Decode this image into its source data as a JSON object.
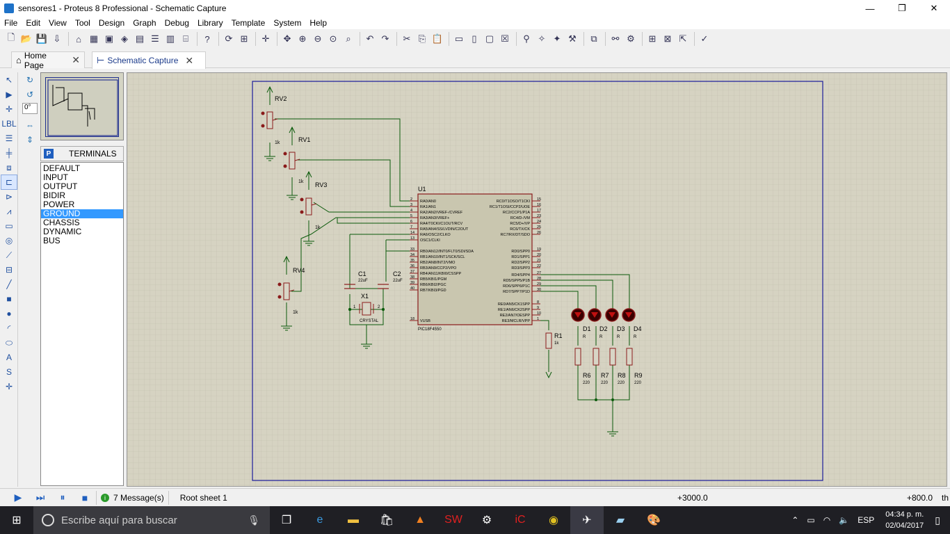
{
  "window": {
    "title": "sensores1 - Proteus 8 Professional - Schematic Capture",
    "minimize": "—",
    "restore": "❐",
    "close": "✕"
  },
  "menu": [
    "File",
    "Edit",
    "View",
    "Tool",
    "Design",
    "Graph",
    "Debug",
    "Library",
    "Template",
    "System",
    "Help"
  ],
  "tabs": [
    {
      "label": "Home Page",
      "icon": "home-icon",
      "active": false
    },
    {
      "label": "Schematic Capture",
      "icon": "schematic-icon",
      "active": true
    }
  ],
  "rotation": {
    "value": "0°"
  },
  "terminals": {
    "mode_badge": "P",
    "header": "TERMINALS",
    "items": [
      "DEFAULT",
      "INPUT",
      "OUTPUT",
      "BIDIR",
      "POWER",
      "GROUND",
      "CHASSIS",
      "DYNAMIC",
      "BUS"
    ],
    "selected": "GROUND"
  },
  "schematic": {
    "pots": [
      {
        "ref": "RV2",
        "value": "1k"
      },
      {
        "ref": "RV1",
        "value": "1k"
      },
      {
        "ref": "RV3",
        "value": "1k"
      },
      {
        "ref": "RV4",
        "value": "1k"
      }
    ],
    "caps": [
      {
        "ref": "C1",
        "value": "22uF"
      },
      {
        "ref": "C2",
        "value": "22uF"
      }
    ],
    "crystal": {
      "ref": "X1",
      "value": "CRYSTAL",
      "pin1": "1",
      "pin2": "2"
    },
    "mcu": {
      "ref": "U1",
      "part": "PIC18F4550",
      "left_pins": [
        {
          "num": "2",
          "name": "RA0/AN0"
        },
        {
          "num": "3",
          "name": "RA1/AN1"
        },
        {
          "num": "4",
          "name": "RA2/AN2/VREF-/CVREF"
        },
        {
          "num": "5",
          "name": "RA3/AN3/VREF+"
        },
        {
          "num": "6",
          "name": "RA4/T0CKI/C1OUT/RCV"
        },
        {
          "num": "7",
          "name": "RA5/AN4/SS/LVDIN/C2OUT"
        },
        {
          "num": "14",
          "name": "RA6/OSC2/CLKO"
        },
        {
          "num": "13",
          "name": "OSC1/CLKI"
        },
        {
          "num": "33",
          "name": "RB0/AN12/INT0/FLT0/SDI/SDA"
        },
        {
          "num": "34",
          "name": "RB1/AN10/INT1/SCK/SCL"
        },
        {
          "num": "35",
          "name": "RB2/AN8/INT2/VMO"
        },
        {
          "num": "36",
          "name": "RB3/AN9/CCP2/VPO"
        },
        {
          "num": "37",
          "name": "RB4/AN11/KBI0/CSSPP"
        },
        {
          "num": "38",
          "name": "RB5/KBI1/PGM"
        },
        {
          "num": "39",
          "name": "RB6/KBI2/PGC"
        },
        {
          "num": "40",
          "name": "RB7/KBI3/PGD"
        },
        {
          "num": "18",
          "name": "VUSB"
        }
      ],
      "right_pins": [
        {
          "num": "15",
          "name": "RC0/T1OSO/T1CKI"
        },
        {
          "num": "16",
          "name": "RC1/T1OSI/CCP2/UOE"
        },
        {
          "num": "17",
          "name": "RC2/CCP1/P1A"
        },
        {
          "num": "23",
          "name": "RC4/D-/VM"
        },
        {
          "num": "24",
          "name": "RC5/D+/VP"
        },
        {
          "num": "25",
          "name": "RC6/TX/CK"
        },
        {
          "num": "26",
          "name": "RC7/RX/DT/SDO"
        },
        {
          "num": "19",
          "name": "RD0/SPP0"
        },
        {
          "num": "20",
          "name": "RD1/SPP1"
        },
        {
          "num": "21",
          "name": "RD2/SPP2"
        },
        {
          "num": "22",
          "name": "RD3/SPP3"
        },
        {
          "num": "27",
          "name": "RD4/SPP4"
        },
        {
          "num": "28",
          "name": "RD5/SPP5/P1B"
        },
        {
          "num": "29",
          "name": "RD6/SPP6/P1C"
        },
        {
          "num": "30",
          "name": "RD7/SPP7/P1D"
        },
        {
          "num": "8",
          "name": "RE0/AN5/CK1SPP"
        },
        {
          "num": "9",
          "name": "RE1/AN6/CK2SPP"
        },
        {
          "num": "10",
          "name": "RE2/AN7/OESPP"
        },
        {
          "num": "1",
          "name": "RE3/MCLR/VPP"
        }
      ]
    },
    "leds": [
      {
        "ref": "D1",
        "value": "R"
      },
      {
        "ref": "D2",
        "value": "R"
      },
      {
        "ref": "D3",
        "value": "R"
      },
      {
        "ref": "D4",
        "value": "R"
      }
    ],
    "led_resistors": [
      {
        "ref": "R6",
        "value": "220"
      },
      {
        "ref": "R7",
        "value": "220"
      },
      {
        "ref": "R8",
        "value": "220"
      },
      {
        "ref": "R9",
        "value": "220"
      }
    ],
    "mclr_resistor": {
      "ref": "R1",
      "value": "1k"
    }
  },
  "status": {
    "messages": "7 Message(s)",
    "sheet": "Root sheet 1",
    "coord_x": "+3000.0",
    "coord_y": "+800.0",
    "unit": "th"
  },
  "taskbar": {
    "search_placeholder": "Escribe aquí para buscar",
    "apps": [
      "task-view-icon",
      "edge-icon",
      "explorer-icon",
      "store-icon",
      "vlc-icon",
      "solidworks-icon",
      "steam-icon",
      "ccleaner-icon",
      "chrome-icon",
      "proteus-icon",
      "notepad-icon",
      "paint-icon"
    ],
    "language": "ESP",
    "time": "04:34 p. m.",
    "date": "02/04/2017"
  }
}
